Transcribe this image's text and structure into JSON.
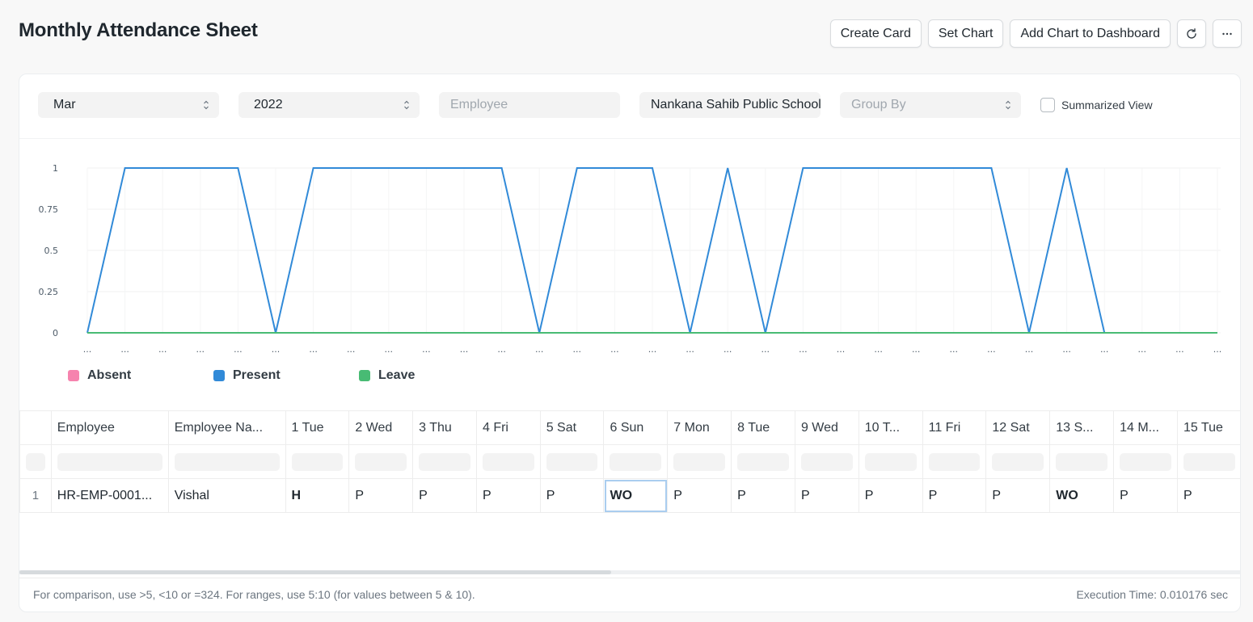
{
  "header": {
    "title": "Monthly Attendance Sheet",
    "buttons": {
      "create_card": "Create Card",
      "set_chart": "Set Chart",
      "add_to_dashboard": "Add Chart to Dashboard"
    }
  },
  "filters": {
    "month": "Mar",
    "year": "2022",
    "employee_placeholder": "Employee",
    "company": "Nankana Sahib Public School",
    "group_by_placeholder": "Group By",
    "summarized_view_label": "Summarized View",
    "summarized_view_checked": false
  },
  "chart_data": {
    "type": "line",
    "x": [
      "...",
      "...",
      "...",
      "...",
      "...",
      "...",
      "...",
      "...",
      "...",
      "...",
      "...",
      "...",
      "...",
      "...",
      "...",
      "...",
      "...",
      "...",
      "...",
      "...",
      "...",
      "...",
      "...",
      "...",
      "...",
      "...",
      "...",
      "...",
      "...",
      "...",
      "..."
    ],
    "yticks": [
      "0",
      "0.25",
      "0.5",
      "0.75",
      "1"
    ],
    "ylim": [
      0,
      1
    ],
    "grid": true,
    "legend_position": "bottom-left",
    "series": [
      {
        "name": "Absent",
        "color": "#f683ae",
        "values": [
          0,
          0,
          0,
          0,
          0,
          0,
          0,
          0,
          0,
          0,
          0,
          0,
          0,
          0,
          0,
          0,
          0,
          0,
          0,
          0,
          0,
          0,
          0,
          0,
          0,
          0,
          0,
          0,
          0,
          0,
          0
        ]
      },
      {
        "name": "Present",
        "color": "#318ad8",
        "values": [
          0,
          1,
          1,
          1,
          1,
          0,
          1,
          1,
          1,
          1,
          1,
          1,
          0,
          1,
          1,
          1,
          0,
          1,
          0,
          1,
          1,
          1,
          1,
          1,
          1,
          0,
          1,
          0,
          0,
          0,
          0
        ]
      },
      {
        "name": "Leave",
        "color": "#48bb74",
        "values": [
          0,
          0,
          0,
          0,
          0,
          0,
          0,
          0,
          0,
          0,
          0,
          0,
          0,
          0,
          0,
          0,
          0,
          0,
          0,
          0,
          0,
          0,
          0,
          0,
          0,
          0,
          0,
          0,
          0,
          0,
          0
        ]
      }
    ]
  },
  "table": {
    "columns": [
      "Employee",
      "Employee Na...",
      "1 Tue",
      "2 Wed",
      "3 Thu",
      "4 Fri",
      "5 Sat",
      "6 Sun",
      "7 Mon",
      "8 Tue",
      "9 Wed",
      "10 T...",
      "11 Fri",
      "12 Sat",
      "13 S...",
      "14 M...",
      "15 Tue"
    ],
    "rows": [
      {
        "num": "1",
        "cells": [
          "HR-EMP-0001...",
          "Vishal",
          "H",
          "P",
          "P",
          "P",
          "P",
          "WO",
          "P",
          "P",
          "P",
          "P",
          "P",
          "P",
          "WO",
          "P",
          "P"
        ]
      }
    ]
  },
  "footer": {
    "hint": "For comparison, use >5, <10 or =324. For ranges, use 5:10 (for values between 5 & 10).",
    "execution_time": "Execution Time: 0.010176 sec"
  },
  "icons": {
    "refresh": "refresh-icon",
    "more": "more-icon",
    "select_arrows": "select-arrows-icon"
  }
}
